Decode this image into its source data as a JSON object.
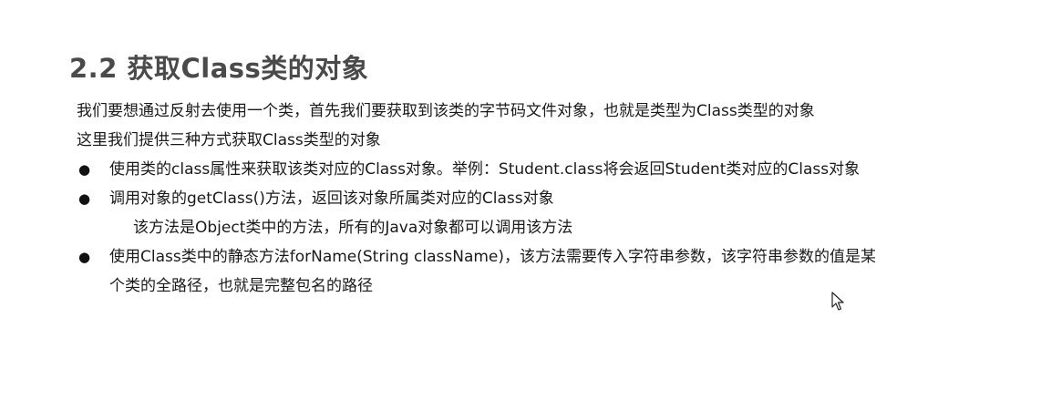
{
  "section": {
    "heading": "2.2 获取Class类的对象"
  },
  "intro": {
    "line1": "我们要想通过反射去使用一个类，首先我们要获取到该类的字节码文件对象，也就是类型为Class类型的对象",
    "line2": "这里我们提供三种方式获取Class类型的对象"
  },
  "bullets": [
    {
      "symbol": "●",
      "text": "使用类的class属性来获取该类对应的Class对象。举例：Student.class将会返回Student类对应的Class对象"
    },
    {
      "symbol": "●",
      "text": "调用对象的getClass()方法，返回该对象所属类对应的Class对象",
      "sub": "该方法是Object类中的方法，所有的Java对象都可以调用该方法"
    },
    {
      "symbol": "●",
      "text": "使用Class类中的静态方法forName(String className)，该方法需要传入字符串参数，该字符串参数的值是某",
      "continuation": "个类的全路径，也就是完整包名的路径"
    }
  ]
}
